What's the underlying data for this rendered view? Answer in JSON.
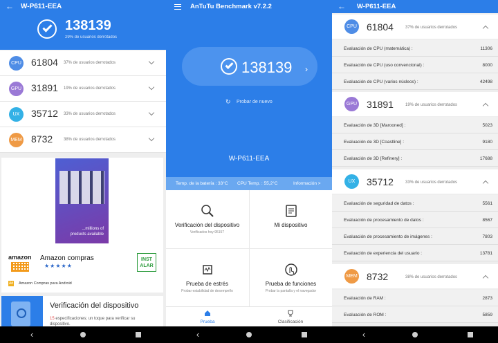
{
  "colors": {
    "blue": "#2c7ee8",
    "cpu": "#4f8de6",
    "gpu": "#9a79d6",
    "ux": "#33b1e6",
    "mem": "#ef9a45"
  },
  "left": {
    "title": "W-P611-EEA",
    "score": "138139",
    "subtitle": "29% de usuarios derrotados",
    "rows": [
      {
        "label": "CPU",
        "score": "61804",
        "pct": "37% de usuarios derrotados"
      },
      {
        "label": "GPU",
        "score": "31891",
        "pct": "19% de usuarios derrotados"
      },
      {
        "label": "UX",
        "score": "35712",
        "pct": "33% de usuarios derrotados"
      },
      {
        "label": "MEM",
        "score": "8732",
        "pct": "38% de usuarios derrotados"
      }
    ],
    "ad": {
      "image_caption_1": "...millions of",
      "image_caption_2": "products available",
      "logo": "amazon",
      "title": "Amazon compras",
      "stars": "★★★★★",
      "install_1": "INST",
      "install_2": "ALAR",
      "marker": "Ad",
      "subtitle": "Amazon Compras para Android"
    },
    "verification": {
      "title": "Verificación del dispositivo",
      "count": "15",
      "desc": " especificaciones; un toque para verificar su dispositivo."
    }
  },
  "middle": {
    "title": "AnTuTu Benchmark v7.2.2",
    "score": "138139",
    "arrow": "›",
    "retry": "Probar de nuevo",
    "device": "W-P611-EEA",
    "battery_temp": "Temp. de la batería : 33°C",
    "cpu_temp": "CPU Temp. : 55,2°C",
    "info": "Información >",
    "cells": [
      {
        "label": "Verificación del dispositivo",
        "sub": "Verificados hoy:95157"
      },
      {
        "label": "Mi dispositivo",
        "sub": ""
      },
      {
        "label": "Prueba de estrés",
        "sub": "Probar estabilidad de desempeño"
      },
      {
        "label": "Prueba de funciones",
        "sub": "Probar la pantalla y el navegador"
      }
    ],
    "tabs": {
      "test": "Prueba",
      "ranking": "Clasificación"
    }
  },
  "right": {
    "title": "W-P611-EEA",
    "sections": [
      {
        "label": "CPU",
        "score": "61804",
        "pct": "37% de usuarios derrotados",
        "items": [
          {
            "name": "Evaluación de CPU (matemática) :",
            "value": "11306"
          },
          {
            "name": "Evaluación de CPU (uso convencional) :",
            "value": "8000"
          },
          {
            "name": "Evaluación de CPU (varios núcleos) :",
            "value": "42498"
          }
        ]
      },
      {
        "label": "GPU",
        "score": "31891",
        "pct": "19% de usuarios derrotados",
        "items": [
          {
            "name": "Evaluación de 3D [Marooned] :",
            "value": "5023"
          },
          {
            "name": "Evaluación de 3D [Coastline] :",
            "value": "9180"
          },
          {
            "name": "Evaluación de 3D [Refinery] :",
            "value": "17688"
          }
        ]
      },
      {
        "label": "UX",
        "score": "35712",
        "pct": "33% de usuarios derrotados",
        "items": [
          {
            "name": "Evaluación de seguridad de datos :",
            "value": "5561"
          },
          {
            "name": "Evaluación de procesamiento de datos :",
            "value": "8567"
          },
          {
            "name": "Evaluación de procesamiento de imágenes :",
            "value": "7803"
          },
          {
            "name": "Evaluación de experiencia del usuario :",
            "value": "13781"
          }
        ]
      },
      {
        "label": "MEM",
        "score": "8732",
        "pct": "38% de usuarios derrotados",
        "items": [
          {
            "name": "Evaluación de RAM :",
            "value": "2873"
          },
          {
            "name": "Evaluación de ROM :",
            "value": "5859"
          }
        ]
      }
    ]
  },
  "nav": {
    "back": "‹"
  }
}
